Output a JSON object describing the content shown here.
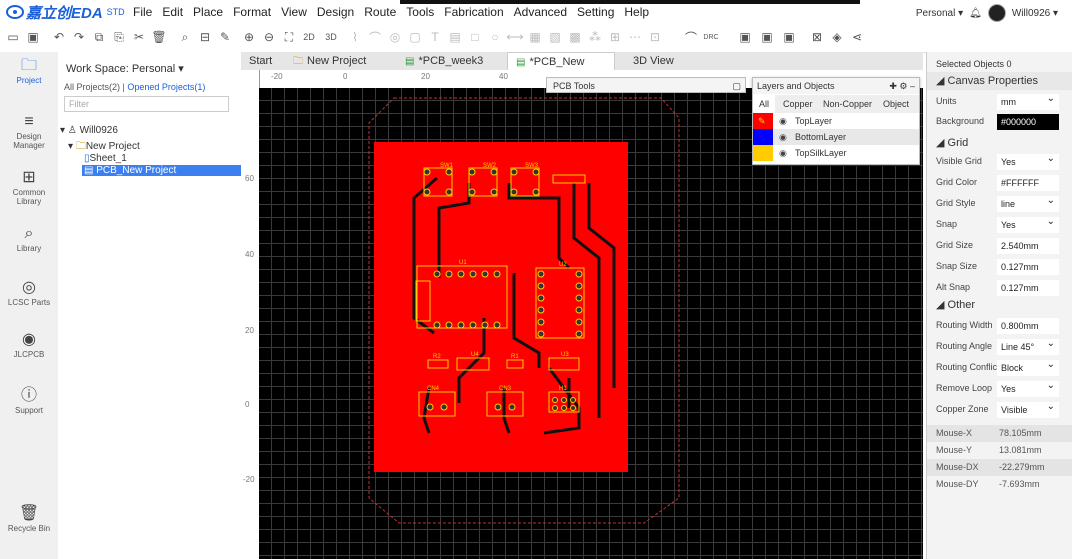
{
  "app": {
    "brand": "嘉立创EDA",
    "edition": "STD"
  },
  "menu": [
    "File",
    "Edit",
    "Place",
    "Format",
    "View",
    "Design",
    "Route",
    "Tools",
    "Fabrication",
    "Advanced",
    "Setting",
    "Help"
  ],
  "user": {
    "workspace": "Personal ▾",
    "name": "Will0926 ▾"
  },
  "toolbar": {
    "icons": [
      "new-file-icon",
      "save-icon",
      "undo-icon",
      "redo-icon",
      "copy-icon",
      "paste-icon",
      "cut-icon",
      "delete-icon",
      "search-icon",
      "align-icon",
      "brush-icon",
      "zoom-in-icon",
      "zoom-out-icon",
      "fit-icon"
    ],
    "view2d": "2D",
    "view3d": "3D",
    "drc": "DRC"
  },
  "rail": [
    {
      "label": "Project",
      "icon": "folder-icon",
      "glyph": "🗀",
      "active": true
    },
    {
      "label": "Design Manager",
      "icon": "design-manager-icon",
      "glyph": "≡"
    },
    {
      "label": "Common Library",
      "icon": "common-library-icon",
      "glyph": "⊞"
    },
    {
      "label": "Library",
      "icon": "library-icon",
      "glyph": "🔍"
    },
    {
      "label": "LCSC Parts",
      "icon": "lcsc-icon",
      "glyph": "◎"
    },
    {
      "label": "JLCPCB",
      "icon": "jlcpcb-icon",
      "glyph": "◉"
    },
    {
      "label": "Support",
      "icon": "support-icon",
      "glyph": "?"
    },
    {
      "label": "Recycle Bin",
      "icon": "trash-icon",
      "glyph": "🗑"
    }
  ],
  "project": {
    "workspace": "Work Space: Personal ▾",
    "all_projects": "All Projects(2)",
    "sep": "|",
    "opened": "Opened Projects(1)",
    "filter_placeholder": "Filter",
    "tree": {
      "owner": "Will0926",
      "project": "New Project",
      "sheet": "Sheet_1",
      "pcb": "PCB_New Project"
    }
  },
  "tabs": [
    {
      "label": "Start"
    },
    {
      "label": "New Project",
      "icon": "schematic-icon"
    },
    {
      "label": "*PCB_week3",
      "icon": "pcb-icon"
    },
    {
      "label": "*PCB_New Project",
      "icon": "pcb-icon",
      "active": true
    },
    {
      "label": "3D View"
    }
  ],
  "ruler": {
    "h": [
      "-20",
      "0",
      "20",
      "40"
    ],
    "v": [
      "60",
      "40",
      "20",
      "0",
      "-20"
    ]
  },
  "pcb_tools": {
    "title": "PCB Tools"
  },
  "layers": {
    "title": "Layers and Objects",
    "tabs": [
      "All",
      "Copper",
      "Non-Copper",
      "Object"
    ],
    "rows": [
      {
        "name": "TopLayer",
        "color": "#ff0000"
      },
      {
        "name": "BottomLayer",
        "color": "#0000ff"
      },
      {
        "name": "TopSilkLayer",
        "color": "#ffcc00"
      }
    ]
  },
  "pcb": {
    "labels": [
      "SW1",
      "SW2",
      "SW3",
      "U1",
      "U2",
      "R2",
      "U4",
      "R1",
      "U3",
      "CN4",
      "CN3",
      "H1"
    ],
    "board_color": "#ff0000",
    "silk_color": "#ffcc00"
  },
  "props": {
    "selected": "Selected Objects   0",
    "canvas_title": "Canvas Properties",
    "units_label": "Units",
    "units": "mm",
    "bg_label": "Background",
    "bg": "#000000",
    "grid_title": "Grid",
    "visible_grid_label": "Visible Grid",
    "visible_grid": "Yes",
    "grid_color_label": "Grid Color",
    "grid_color": "#FFFFFF",
    "grid_style_label": "Grid Style",
    "grid_style": "line",
    "snap_label": "Snap",
    "snap": "Yes",
    "grid_size_label": "Grid Size",
    "grid_size": "2.540mm",
    "snap_size_label": "Snap Size",
    "snap_size": "0.127mm",
    "alt_snap_label": "Alt Snap",
    "alt_snap": "0.127mm",
    "other_title": "Other",
    "routing_width_label": "Routing Width",
    "routing_width": "0.800mm",
    "routing_angle_label": "Routing Angle",
    "routing_angle": "Line 45°",
    "routing_conflict_label": "Routing Conflict",
    "routing_conflict": "Block",
    "remove_loop_label": "Remove Loop",
    "remove_loop": "Yes",
    "copper_zone_label": "Copper Zone",
    "copper_zone": "Visible",
    "mouse": [
      {
        "label": "Mouse-X",
        "value": "78.105mm"
      },
      {
        "label": "Mouse-Y",
        "value": "13.081mm"
      },
      {
        "label": "Mouse-DX",
        "value": "-22.279mm"
      },
      {
        "label": "Mouse-DY",
        "value": "-7.693mm"
      }
    ]
  }
}
